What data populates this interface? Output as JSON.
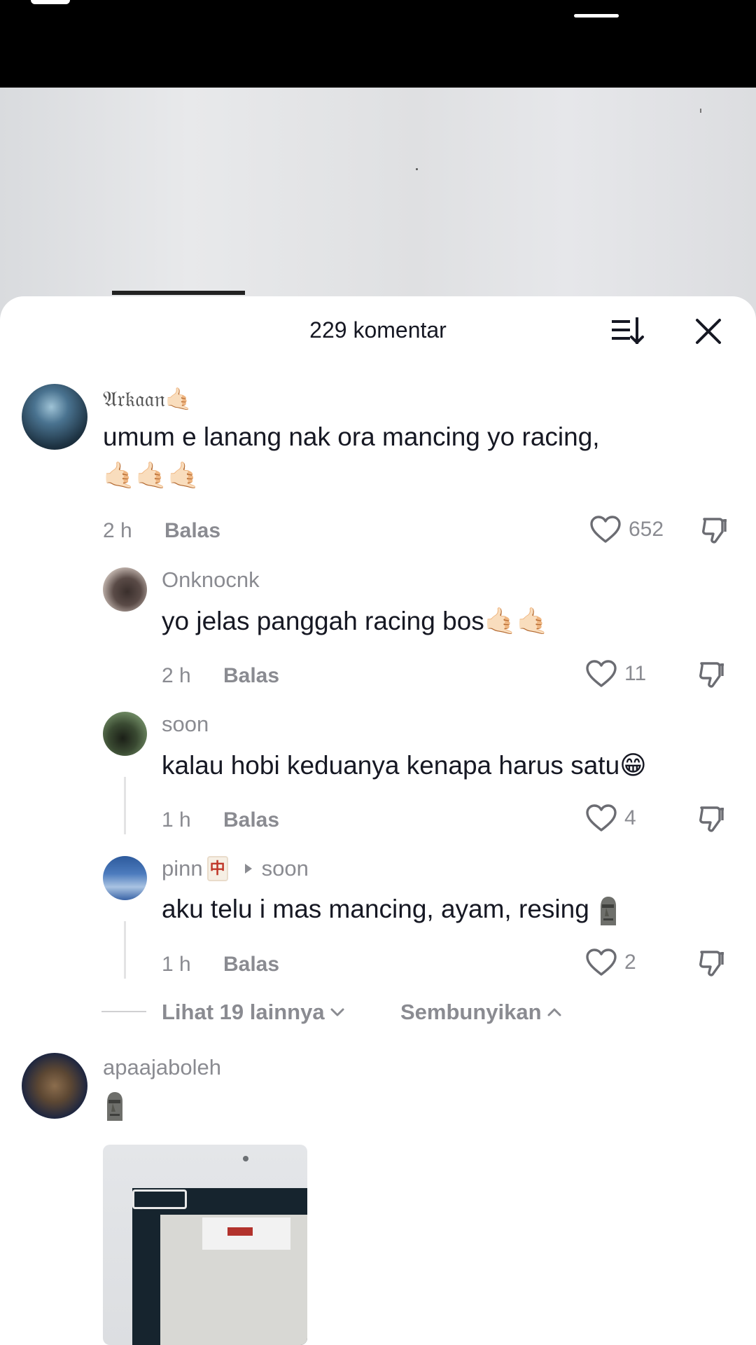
{
  "sheet": {
    "title": "229 komentar",
    "sort_icon": "sort-icon",
    "close_icon": "close-icon"
  },
  "colors": {
    "text_primary": "#161823",
    "text_secondary": "#8a8b91",
    "thread_line": "#e3e3e4"
  },
  "comments": [
    {
      "username": "𝔄𝔯𝔨𝔞𝔞𝔫🤙🏻",
      "text_line1": "umum e lanang nak ora mancing yo racing,",
      "text_line2": "🤙🏻🤙🏻🤙🏻",
      "time": "2 h",
      "reply_label": "Balas",
      "likes": "652"
    },
    {
      "username": "Onknocnk",
      "text": "yo jelas panggah racing bos🤙🏻🤙🏻",
      "time": "2 h",
      "reply_label": "Balas",
      "likes": "11"
    },
    {
      "username": "soon",
      "text": "kalau hobi keduanya kenapa harus satu😁",
      "time": "1 h",
      "reply_label": "Balas",
      "likes": "4"
    },
    {
      "username": "pinn",
      "username_badge": "中",
      "reply_to": "soon",
      "text": "aku telu i mas mancing, ayam, resing",
      "time": "1 h",
      "reply_label": "Balas",
      "likes": "2"
    },
    {
      "username": "apaajaboleh"
    }
  ],
  "replies_controls": {
    "view_more": "Lihat 19 lainnya",
    "hide": "Sembunyikan"
  }
}
